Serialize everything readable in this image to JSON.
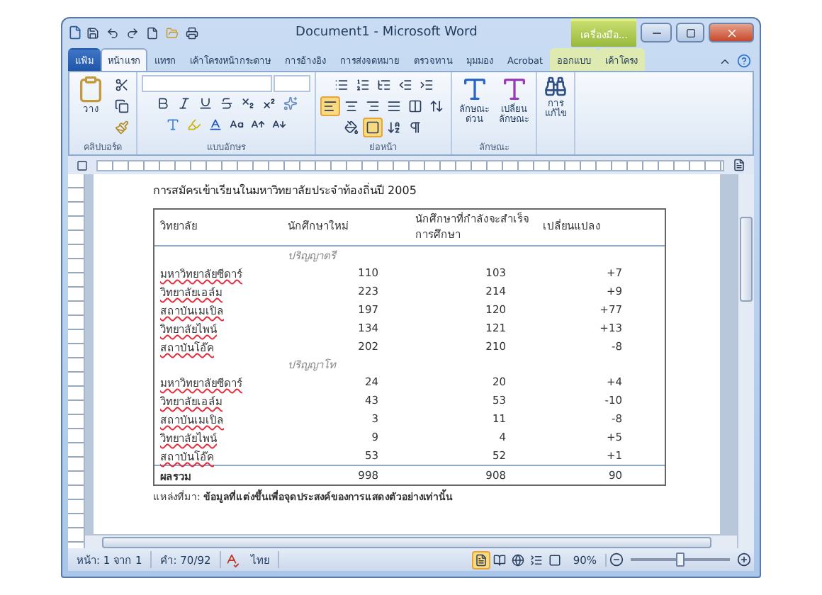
{
  "window": {
    "title": "Document1 - Microsoft Word",
    "contextual_tab": "เครื่องมือ..."
  },
  "tabs": [
    {
      "label": "แฟ้ม",
      "kind": "file",
      "selected": false
    },
    {
      "label": "หน้าแรก",
      "kind": "tab",
      "selected": true
    },
    {
      "label": "แทรก",
      "kind": "tab",
      "selected": false
    },
    {
      "label": "เค้าโครงหน้ากระดาษ",
      "kind": "tab",
      "selected": false
    },
    {
      "label": "การอ้างอิง",
      "kind": "tab",
      "selected": false
    },
    {
      "label": "การส่งจดหมาย",
      "kind": "tab",
      "selected": false
    },
    {
      "label": "ตรวจทาน",
      "kind": "tab",
      "selected": false
    },
    {
      "label": "มุมมอง",
      "kind": "tab",
      "selected": false
    },
    {
      "label": "Acrobat",
      "kind": "tab",
      "selected": false
    },
    {
      "label": "ออกแบบ",
      "kind": "context",
      "selected": false
    },
    {
      "label": "เค้าโครง",
      "kind": "context",
      "selected": false
    }
  ],
  "ribbon": {
    "paste_label": "วาง",
    "group_labels": [
      "คลิปบอร์ด",
      "แบบอักษร",
      "ย่อหน้า",
      "ลักษณะ"
    ],
    "alignment": [
      {
        "kind": "left",
        "selected": true
      },
      {
        "kind": "center",
        "selected": false
      },
      {
        "kind": "right",
        "selected": false
      },
      {
        "kind": "justify",
        "selected": false
      }
    ],
    "borders_selected": true,
    "quick_styles": "ลักษณะ ด่วน",
    "change_styles": "เปลี่ยน ลักษณะ",
    "editing": "การ แก้ไข"
  },
  "document": {
    "heading": "การสมัครเข้าเรียนในมหาวิทยาลัยประจำท้องถิ่นปี 2005",
    "columns": [
      "วิทยาลัย",
      "นักศึกษาใหม่",
      "นักศึกษาที่กำลังจะสำเร็จการศึกษา",
      "เปลี่ยนแปลง"
    ],
    "sections": [
      {
        "label": "ปริญญาตรี",
        "rows": [
          [
            "มหาวิทยาลัยซีดาร์",
            "110",
            "103",
            "+7"
          ],
          [
            "วิทยาลัยเอล์ม",
            "223",
            "214",
            "+9"
          ],
          [
            "สถาบันเมเปิล",
            "197",
            "120",
            "+77"
          ],
          [
            "วิทยาลัยไพน์",
            "134",
            "121",
            "+13"
          ],
          [
            "สถาบันโอ๊ค",
            "202",
            "210",
            "-8"
          ]
        ]
      },
      {
        "label": "ปริญญาโท",
        "rows": [
          [
            "มหาวิทยาลัยซีดาร์",
            "24",
            "20",
            "+4"
          ],
          [
            "วิทยาลัยเอล์ม",
            "43",
            "53",
            "-10"
          ],
          [
            "สถาบันเมเปิล",
            "3",
            "11",
            "-8"
          ],
          [
            "วิทยาลัยไพน์",
            "9",
            "4",
            "+5"
          ],
          [
            "สถาบันโอ๊ค",
            "53",
            "52",
            "+1"
          ]
        ]
      }
    ],
    "total": [
      "ผลรวม",
      "998",
      "908",
      "90"
    ],
    "footnote_label": "แหล่งที่มา:",
    "footnote": "ข้อมูลที่แต่งขึ้นเพื่อจุดประสงค์ของการแสดงตัวอย่างเท่านั้น"
  },
  "status_bar": {
    "page": "หน้า: 1 จาก 1",
    "words": "คำ: 70/92",
    "language": "ไทย",
    "views": [
      {
        "kind": "print",
        "selected": true
      },
      {
        "kind": "reading",
        "selected": false
      },
      {
        "kind": "web",
        "selected": false
      },
      {
        "kind": "outline",
        "selected": false
      },
      {
        "kind": "draft",
        "selected": false
      }
    ],
    "zoom": "90%",
    "zoom_slider": {
      "level": 0.5
    }
  }
}
